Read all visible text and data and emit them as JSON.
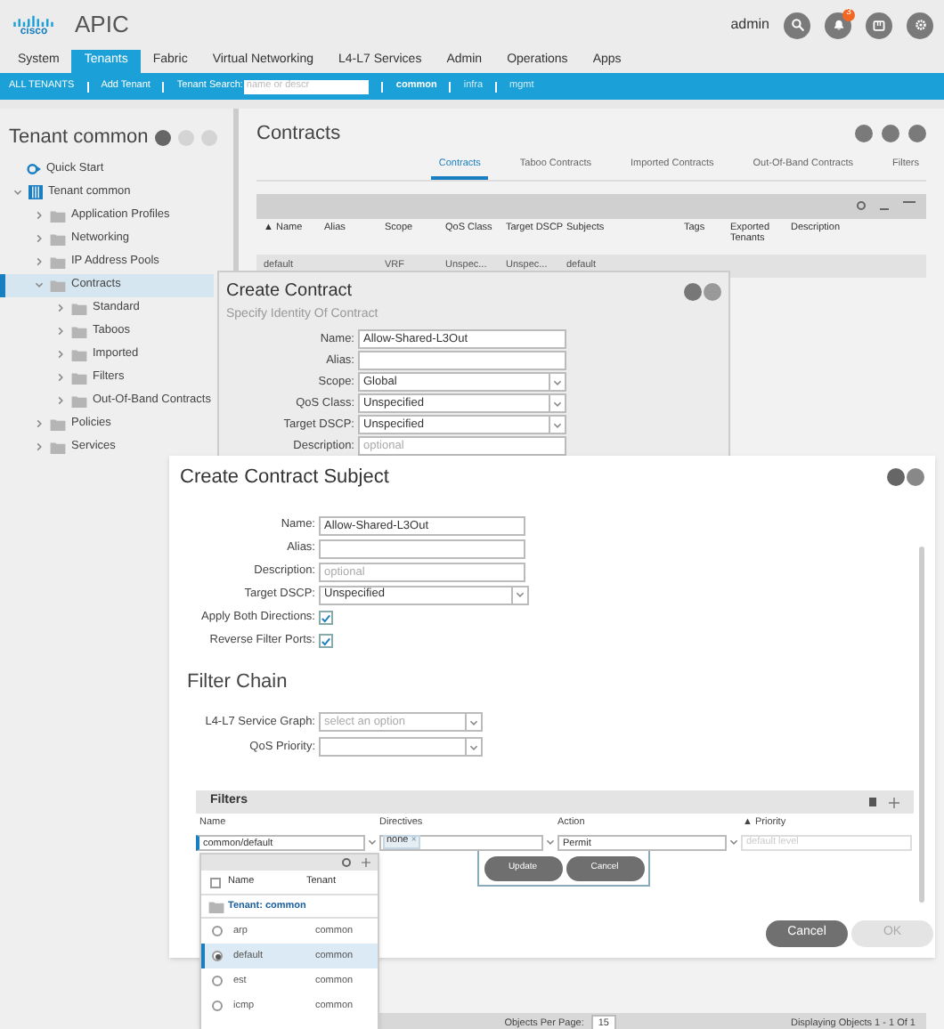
{
  "header": {
    "brand": "cisco",
    "app": "APIC",
    "user": "admin",
    "alert_count": "3"
  },
  "nav_tabs": [
    {
      "label": "System",
      "selected": false
    },
    {
      "label": "Tenants",
      "selected": true
    },
    {
      "label": "Fabric",
      "selected": false
    },
    {
      "label": "Virtual Networking",
      "selected": false
    },
    {
      "label": "L4-L7 Services",
      "selected": false
    },
    {
      "label": "Admin",
      "selected": false
    },
    {
      "label": "Operations",
      "selected": false
    },
    {
      "label": "Apps",
      "selected": false
    }
  ],
  "subbar": {
    "all_tenants": "ALL TENANTS",
    "add_tenant": "Add Tenant",
    "search_label": "Tenant Search:",
    "search_placeholder": "name or descr",
    "tenants": [
      {
        "label": "common",
        "selected": true
      },
      {
        "label": "infra",
        "selected": false
      },
      {
        "label": "mgmt",
        "selected": false
      }
    ]
  },
  "sidebar": {
    "title": "Tenant common",
    "items": [
      {
        "label": "Quick Start",
        "kind": "link",
        "selected": false
      },
      {
        "label": "Tenant common",
        "kind": "tenant",
        "expanded": true,
        "selected": false,
        "children": [
          {
            "label": "Application Profiles",
            "kind": "folder",
            "expanded": false,
            "selected": false
          },
          {
            "label": "Networking",
            "kind": "folder",
            "expanded": false,
            "selected": false
          },
          {
            "label": "IP Address Pools",
            "kind": "folder",
            "expanded": false,
            "selected": false
          },
          {
            "label": "Contracts",
            "kind": "folder",
            "expanded": true,
            "selected": true,
            "children": [
              {
                "label": "Standard",
                "kind": "folder",
                "expanded": false,
                "selected": false
              },
              {
                "label": "Taboos",
                "kind": "folder",
                "expanded": false,
                "selected": false
              },
              {
                "label": "Imported",
                "kind": "folder",
                "expanded": false,
                "selected": false
              },
              {
                "label": "Filters",
                "kind": "folder",
                "expanded": false,
                "selected": false
              },
              {
                "label": "Out-Of-Band Contracts",
                "kind": "folder",
                "expanded": false,
                "selected": false
              }
            ]
          },
          {
            "label": "Policies",
            "kind": "folder",
            "expanded": false,
            "selected": false
          },
          {
            "label": "Services",
            "kind": "folder",
            "expanded": false,
            "selected": false
          }
        ]
      }
    ]
  },
  "content": {
    "title": "Contracts",
    "tabs": [
      {
        "label": "Contracts",
        "selected": true
      },
      {
        "label": "Taboo Contracts",
        "selected": false
      },
      {
        "label": "Imported Contracts",
        "selected": false
      },
      {
        "label": "Out-Of-Band Contracts",
        "selected": false
      },
      {
        "label": "Filters",
        "selected": false
      }
    ],
    "table": {
      "columns": [
        "Name",
        "Alias",
        "Scope",
        "QoS Class",
        "Target DSCP",
        "Subjects",
        "Tags",
        "Exported Tenants",
        "Description"
      ],
      "sort_mark": "▲",
      "rows": [
        {
          "Name": "default",
          "Scope": "VRF",
          "QoS Class": "Unspec...",
          "Target DSCP": "Unspec...",
          "Subjects": "default"
        }
      ]
    },
    "pager": {
      "per_page_label": "Objects Per Page:",
      "per_page": "15",
      "displaying": "Displaying Objects 1 - 1 Of 1"
    }
  },
  "create_contract": {
    "title": "Create Contract",
    "subtitle": "Specify Identity Of Contract",
    "fields": [
      {
        "label": "Name:",
        "kind": "text",
        "value": "Allow-Shared-L3Out"
      },
      {
        "label": "Alias:",
        "kind": "text"
      },
      {
        "label": "Scope:",
        "kind": "select",
        "value": "Global"
      },
      {
        "label": "QoS Class:",
        "kind": "select",
        "value": "Unspecified"
      },
      {
        "label": "Target DSCP:",
        "kind": "select",
        "value": "Unspecified"
      },
      {
        "label": "Description:",
        "kind": "text",
        "placeholder": "optional"
      }
    ]
  },
  "create_subject": {
    "title": "Create Contract Subject",
    "fields": [
      {
        "label": "Name:",
        "kind": "text",
        "value": "Allow-Shared-L3Out"
      },
      {
        "label": "Alias:",
        "kind": "text"
      },
      {
        "label": "Description:",
        "kind": "text",
        "placeholder": "optional"
      },
      {
        "label": "Target DSCP:",
        "kind": "select",
        "value": "Unspecified"
      },
      {
        "label": "Apply Both Directions:",
        "kind": "checkbox",
        "checked": true
      },
      {
        "label": "Reverse Filter Ports:",
        "kind": "checkbox",
        "checked": true
      }
    ],
    "filter_chain": {
      "title": "Filter Chain",
      "fields": [
        {
          "label": "L4-L7 Service Graph:",
          "kind": "select",
          "placeholder": "select an option"
        },
        {
          "label": "QoS Priority:",
          "kind": "select"
        }
      ]
    },
    "filters": {
      "title": "Filters",
      "columns": [
        "Name",
        "Directives",
        "Action",
        "Priority"
      ],
      "sort_mark": "▲",
      "edit_row": {
        "name": "common/default",
        "directive_tag": "none",
        "directive_remove": "×",
        "action": "Permit",
        "priority_placeholder": "default level"
      },
      "row_buttons": [
        "Update",
        "Cancel"
      ]
    },
    "buttons": [
      {
        "label": "Cancel",
        "disabled": false
      },
      {
        "label": "OK",
        "disabled": true
      }
    ]
  },
  "filter_dropdown": {
    "select_all": {
      "checked": false
    },
    "columns": [
      "Name",
      "Tenant"
    ],
    "group": "Tenant: common",
    "rows": [
      {
        "name": "arp",
        "tenant": "common",
        "selected": false
      },
      {
        "name": "default",
        "tenant": "common",
        "selected": true
      },
      {
        "name": "est",
        "tenant": "common",
        "selected": false
      },
      {
        "name": "icmp",
        "tenant": "common",
        "selected": false
      }
    ]
  }
}
